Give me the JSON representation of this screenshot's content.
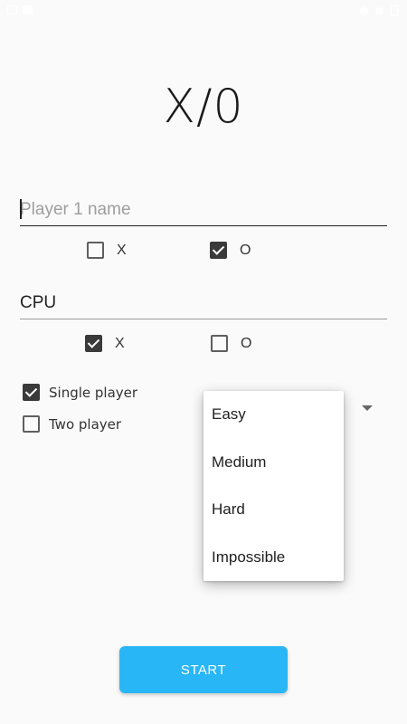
{
  "app": {
    "title": "X/0"
  },
  "player1": {
    "placeholder": "Player 1 name",
    "value": "",
    "options": [
      {
        "label": "X",
        "checked": false
      },
      {
        "label": "O",
        "checked": true
      }
    ]
  },
  "cpu": {
    "name": "CPU",
    "options": [
      {
        "label": "X",
        "checked": true
      },
      {
        "label": "O",
        "checked": false
      }
    ]
  },
  "modes": [
    {
      "label": "Single player",
      "checked": true
    },
    {
      "label": "Two player",
      "checked": false
    }
  ],
  "difficulty": {
    "options": [
      "Easy",
      "Medium",
      "Hard",
      "Impossible"
    ]
  },
  "start_button": {
    "label": "START"
  },
  "colors": {
    "accent": "#29b6f6",
    "checkbox_checked": "#3a3a3a",
    "background": "#fafafa"
  }
}
